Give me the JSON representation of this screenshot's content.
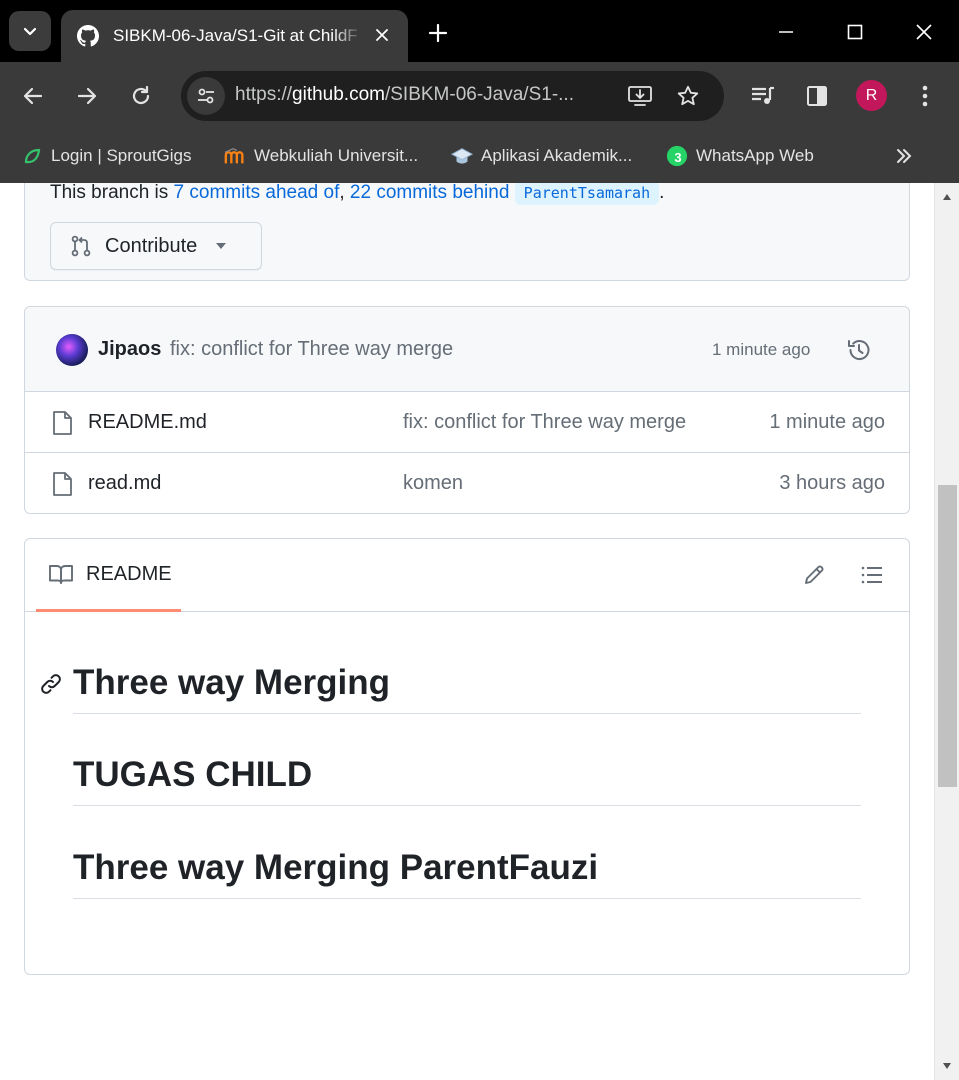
{
  "browser": {
    "tab_title": "SIBKM-06-Java/S1-Git at ChildF",
    "url_scheme": "https://",
    "url_host": "github.com",
    "url_path": "/SIBKM-06-Java/S1-...",
    "profile_initial": "R"
  },
  "bookmarks": [
    {
      "label": "Login | SproutGigs",
      "icon": "sproutgigs-icon"
    },
    {
      "label": "Webkuliah Universit...",
      "icon": "moodle-icon"
    },
    {
      "label": "Aplikasi Akademik...",
      "icon": "graduation-cap-icon"
    },
    {
      "label": "WhatsApp Web",
      "icon": "whatsapp-icon",
      "badge": "3"
    }
  ],
  "branch_status": {
    "prefix": "This branch is ",
    "ahead": "7 commits ahead of",
    "sep": ", ",
    "behind": "22 commits behind",
    "branch": "ParentTsamarah",
    "suffix": ".",
    "contribute_label": "Contribute"
  },
  "latest_commit": {
    "author": "Jipaos",
    "message": "fix: conflict for Three way merge",
    "time": "1 minute ago"
  },
  "files": [
    {
      "name": "README.md",
      "commit": "fix: conflict for Three way merge",
      "time": "1 minute ago"
    },
    {
      "name": "read.md",
      "commit": "komen",
      "time": "3 hours ago"
    }
  ],
  "readme": {
    "tab_label": "README",
    "headings": [
      "Three way Merging",
      "TUGAS CHILD",
      "Three way Merging ParentFauzi"
    ]
  }
}
